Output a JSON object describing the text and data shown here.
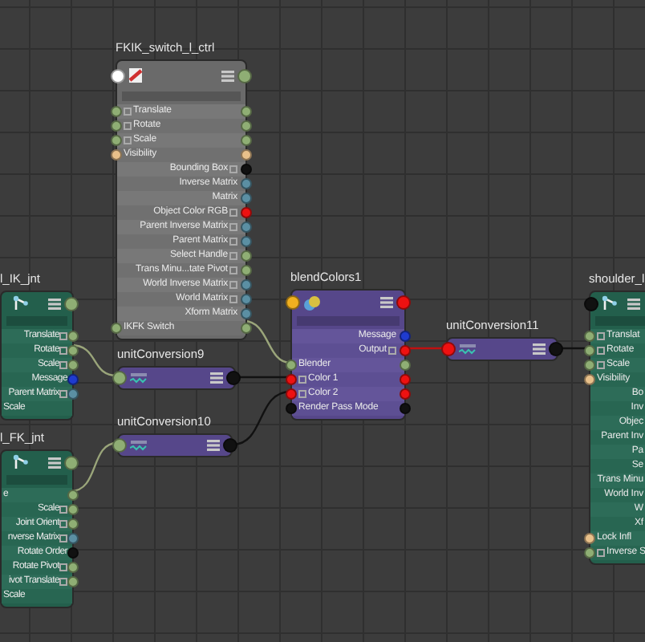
{
  "nodes": [
    {
      "title": "FKIK_switch_l_ctrl",
      "kind": "transform",
      "ports": [
        {
          "kind": "in",
          "color": "#ffffff"
        },
        {
          "kind": "out",
          "color": "#8fae74"
        }
      ],
      "attributes": [
        {
          "label": "Translate",
          "kind": "in",
          "expandable": true,
          "ports": [
            {
              "kind": "in",
              "color": "#8fae74"
            },
            {
              "kind": "out",
              "color": "#8fae74"
            }
          ]
        },
        {
          "label": "Rotate",
          "kind": "in",
          "expandable": true,
          "ports": [
            {
              "kind": "in",
              "color": "#8fae74"
            },
            {
              "kind": "out",
              "color": "#8fae74"
            }
          ]
        },
        {
          "label": "Scale",
          "kind": "in",
          "expandable": true,
          "ports": [
            {
              "kind": "in",
              "color": "#8fae74"
            },
            {
              "kind": "out",
              "color": "#8fae74"
            }
          ]
        },
        {
          "label": "Visibility",
          "kind": "in",
          "expandable": false,
          "ports": [
            {
              "kind": "in",
              "color": "#e8c08a"
            },
            {
              "kind": "out",
              "color": "#e8c08a"
            }
          ]
        },
        {
          "label": "Bounding Box",
          "kind": "out",
          "expandable": true,
          "ports": [
            {
              "kind": "out",
              "color": "#111111"
            }
          ]
        },
        {
          "label": "Inverse Matrix",
          "kind": "out",
          "expandable": false,
          "ports": [
            {
              "kind": "out",
              "color": "#5b8fa3"
            }
          ]
        },
        {
          "label": "Matrix",
          "kind": "out",
          "expandable": false,
          "ports": [
            {
              "kind": "out",
              "color": "#5b8fa3"
            }
          ]
        },
        {
          "label": "Object Color RGB",
          "kind": "out",
          "expandable": true,
          "ports": [
            {
              "kind": "out",
              "color": "#ee1111"
            }
          ]
        },
        {
          "label": "Parent Inverse Matrix",
          "kind": "out",
          "expandable": true,
          "ports": [
            {
              "kind": "out",
              "color": "#5b8fa3"
            }
          ]
        },
        {
          "label": "Parent Matrix",
          "kind": "out",
          "expandable": true,
          "ports": [
            {
              "kind": "out",
              "color": "#5b8fa3"
            }
          ]
        },
        {
          "label": "Select Handle",
          "kind": "out",
          "expandable": true,
          "ports": [
            {
              "kind": "out",
              "color": "#8fae74"
            }
          ]
        },
        {
          "label": "Trans Minu...tate Pivot",
          "kind": "out",
          "expandable": true,
          "ports": [
            {
              "kind": "out",
              "color": "#8fae74"
            }
          ]
        },
        {
          "label": "World Inverse Matrix",
          "kind": "out",
          "expandable": true,
          "ports": [
            {
              "kind": "out",
              "color": "#5b8fa3"
            }
          ]
        },
        {
          "label": "World Matrix",
          "kind": "out",
          "expandable": true,
          "ports": [
            {
              "kind": "out",
              "color": "#5b8fa3"
            }
          ]
        },
        {
          "label": "Xform Matrix",
          "kind": "out",
          "expandable": false,
          "ports": [
            {
              "kind": "out",
              "color": "#5b8fa3"
            }
          ]
        },
        {
          "label": "IKFK Switch",
          "kind": "in",
          "expandable": false,
          "ports": [
            {
              "kind": "in",
              "color": "#8fae74"
            },
            {
              "kind": "out",
              "color": "#8fae74"
            }
          ]
        }
      ]
    },
    {
      "title": "l_IK_jnt",
      "kind": "joint",
      "ports": [
        {
          "kind": "out",
          "color": "#8fae74"
        }
      ],
      "attributes": [
        {
          "label": "Translate",
          "kind": "out",
          "expandable": true,
          "ports": [
            {
              "kind": "out",
              "color": "#8fae74"
            }
          ]
        },
        {
          "label": "Rotate",
          "kind": "out",
          "expandable": true,
          "ports": [
            {
              "kind": "out",
              "color": "#8fae74"
            }
          ]
        },
        {
          "label": "Scale",
          "kind": "out",
          "expandable": true,
          "ports": [
            {
              "kind": "out",
              "color": "#8fae74"
            }
          ]
        },
        {
          "label": "Message",
          "kind": "out",
          "expandable": false,
          "ports": [
            {
              "kind": "out",
              "color": "#1f3bd0"
            }
          ]
        },
        {
          "label": "Parent Matrix",
          "kind": "out",
          "expandable": true,
          "ports": [
            {
              "kind": "out",
              "color": "#5b8fa3"
            }
          ]
        },
        {
          "label": "Scale",
          "kind": "in",
          "expandable": false
        }
      ]
    },
    {
      "title": "l_FK_jnt",
      "kind": "joint",
      "ports": [
        {
          "kind": "out",
          "color": "#8fae74"
        }
      ],
      "attributes": [
        {
          "label": "e",
          "kind": "in",
          "expandable": false,
          "ports": [
            {
              "kind": "out",
              "color": "#8fae74"
            }
          ]
        },
        {
          "label": "Scale",
          "kind": "out",
          "expandable": true,
          "ports": [
            {
              "kind": "out",
              "color": "#8fae74"
            }
          ]
        },
        {
          "label": "Joint Orient",
          "kind": "out",
          "expandable": true,
          "ports": [
            {
              "kind": "out",
              "color": "#8fae74"
            }
          ]
        },
        {
          "label": "nverse Matrix",
          "kind": "out",
          "expandable": true,
          "ports": [
            {
              "kind": "out",
              "color": "#5b8fa3"
            }
          ]
        },
        {
          "label": "Rotate Order",
          "kind": "out",
          "expandable": false,
          "ports": [
            {
              "kind": "out",
              "color": "#111111"
            }
          ]
        },
        {
          "label": "Rotate Pivot",
          "kind": "out",
          "expandable": true,
          "ports": [
            {
              "kind": "out",
              "color": "#8fae74"
            }
          ]
        },
        {
          "label": "ivot Translate",
          "kind": "out",
          "expandable": true,
          "ports": [
            {
              "kind": "out",
              "color": "#8fae74"
            }
          ]
        },
        {
          "label": "Scale",
          "kind": "in",
          "expandable": false
        }
      ]
    },
    {
      "title": "unitConversion9",
      "kind": "conversion",
      "ports": [
        {
          "kind": "in",
          "color": "#8fae74"
        },
        {
          "kind": "out",
          "color": "#111111"
        }
      ]
    },
    {
      "title": "unitConversion10",
      "kind": "conversion",
      "ports": [
        {
          "kind": "in",
          "color": "#8fae74"
        },
        {
          "kind": "out",
          "color": "#111111"
        }
      ]
    },
    {
      "title": "blendColors1",
      "kind": "blend",
      "ports": [
        {
          "kind": "in",
          "color": "#f0b020"
        },
        {
          "kind": "out",
          "color": "#ee1111"
        }
      ],
      "attributes": [
        {
          "label": "Message",
          "kind": "out",
          "expandable": false,
          "ports": [
            {
              "kind": "out",
              "color": "#1f3bd0"
            }
          ]
        },
        {
          "label": "Output",
          "kind": "out",
          "expandable": true,
          "ports": [
            {
              "kind": "out",
              "color": "#ee1111"
            }
          ]
        },
        {
          "label": "Blender",
          "kind": "in",
          "expandable": false,
          "ports": [
            {
              "kind": "in",
              "color": "#8fae74"
            },
            {
              "kind": "out",
              "color": "#8fae74"
            }
          ]
        },
        {
          "label": "Color 1",
          "kind": "in",
          "expandable": true,
          "ports": [
            {
              "kind": "in",
              "color": "#ee1111"
            },
            {
              "kind": "out",
              "color": "#ee1111"
            }
          ]
        },
        {
          "label": "Color 2",
          "kind": "in",
          "expandable": true,
          "ports": [
            {
              "kind": "in",
              "color": "#ee1111"
            },
            {
              "kind": "out",
              "color": "#ee1111"
            }
          ]
        },
        {
          "label": "Render Pass Mode",
          "kind": "in",
          "expandable": false,
          "ports": [
            {
              "kind": "in",
              "color": "#111111"
            },
            {
              "kind": "out",
              "color": "#111111"
            }
          ]
        }
      ]
    },
    {
      "title": "unitConversion11",
      "kind": "conversion",
      "ports": [
        {
          "kind": "in",
          "color": "#ee1111"
        },
        {
          "kind": "out",
          "color": "#111111"
        }
      ]
    },
    {
      "title": "shoulder_l",
      "kind": "joint",
      "ports": [
        {
          "kind": "in",
          "color": "#111111"
        }
      ],
      "attributes": [
        {
          "label": "Translat",
          "kind": "in",
          "expandable": true,
          "ports": [
            {
              "kind": "in",
              "color": "#8fae74"
            }
          ]
        },
        {
          "label": "Rotate",
          "kind": "in",
          "expandable": true,
          "ports": [
            {
              "kind": "in",
              "color": "#8fae74"
            }
          ]
        },
        {
          "label": "Scale",
          "kind": "in",
          "expandable": true,
          "ports": [
            {
              "kind": "in",
              "color": "#8fae74"
            }
          ]
        },
        {
          "label": "Visibility",
          "kind": "in",
          "expandable": false,
          "ports": [
            {
              "kind": "in",
              "color": "#e8c08a"
            }
          ]
        },
        {
          "label": "Bo",
          "kind": "out",
          "expandable": false
        },
        {
          "label": "Inv",
          "kind": "out",
          "expandable": false
        },
        {
          "label": "Objec",
          "kind": "out",
          "expandable": false
        },
        {
          "label": "Parent Inv",
          "kind": "out",
          "expandable": false
        },
        {
          "label": "Pa",
          "kind": "out",
          "expandable": false
        },
        {
          "label": "Se",
          "kind": "out",
          "expandable": false
        },
        {
          "label": "Trans Minu",
          "kind": "out",
          "expandable": false
        },
        {
          "label": "World Inv",
          "kind": "out",
          "expandable": false
        },
        {
          "label": "W",
          "kind": "out",
          "expandable": false
        },
        {
          "label": "Xf",
          "kind": "out",
          "expandable": false
        },
        {
          "label": "Lock Infl",
          "kind": "in",
          "expandable": false,
          "ports": [
            {
              "kind": "in",
              "color": "#e8c08a"
            }
          ]
        },
        {
          "label": "Inverse S",
          "kind": "in",
          "expandable": true,
          "ports": [
            {
              "kind": "in",
              "color": "#8fae74"
            }
          ]
        }
      ]
    }
  ]
}
